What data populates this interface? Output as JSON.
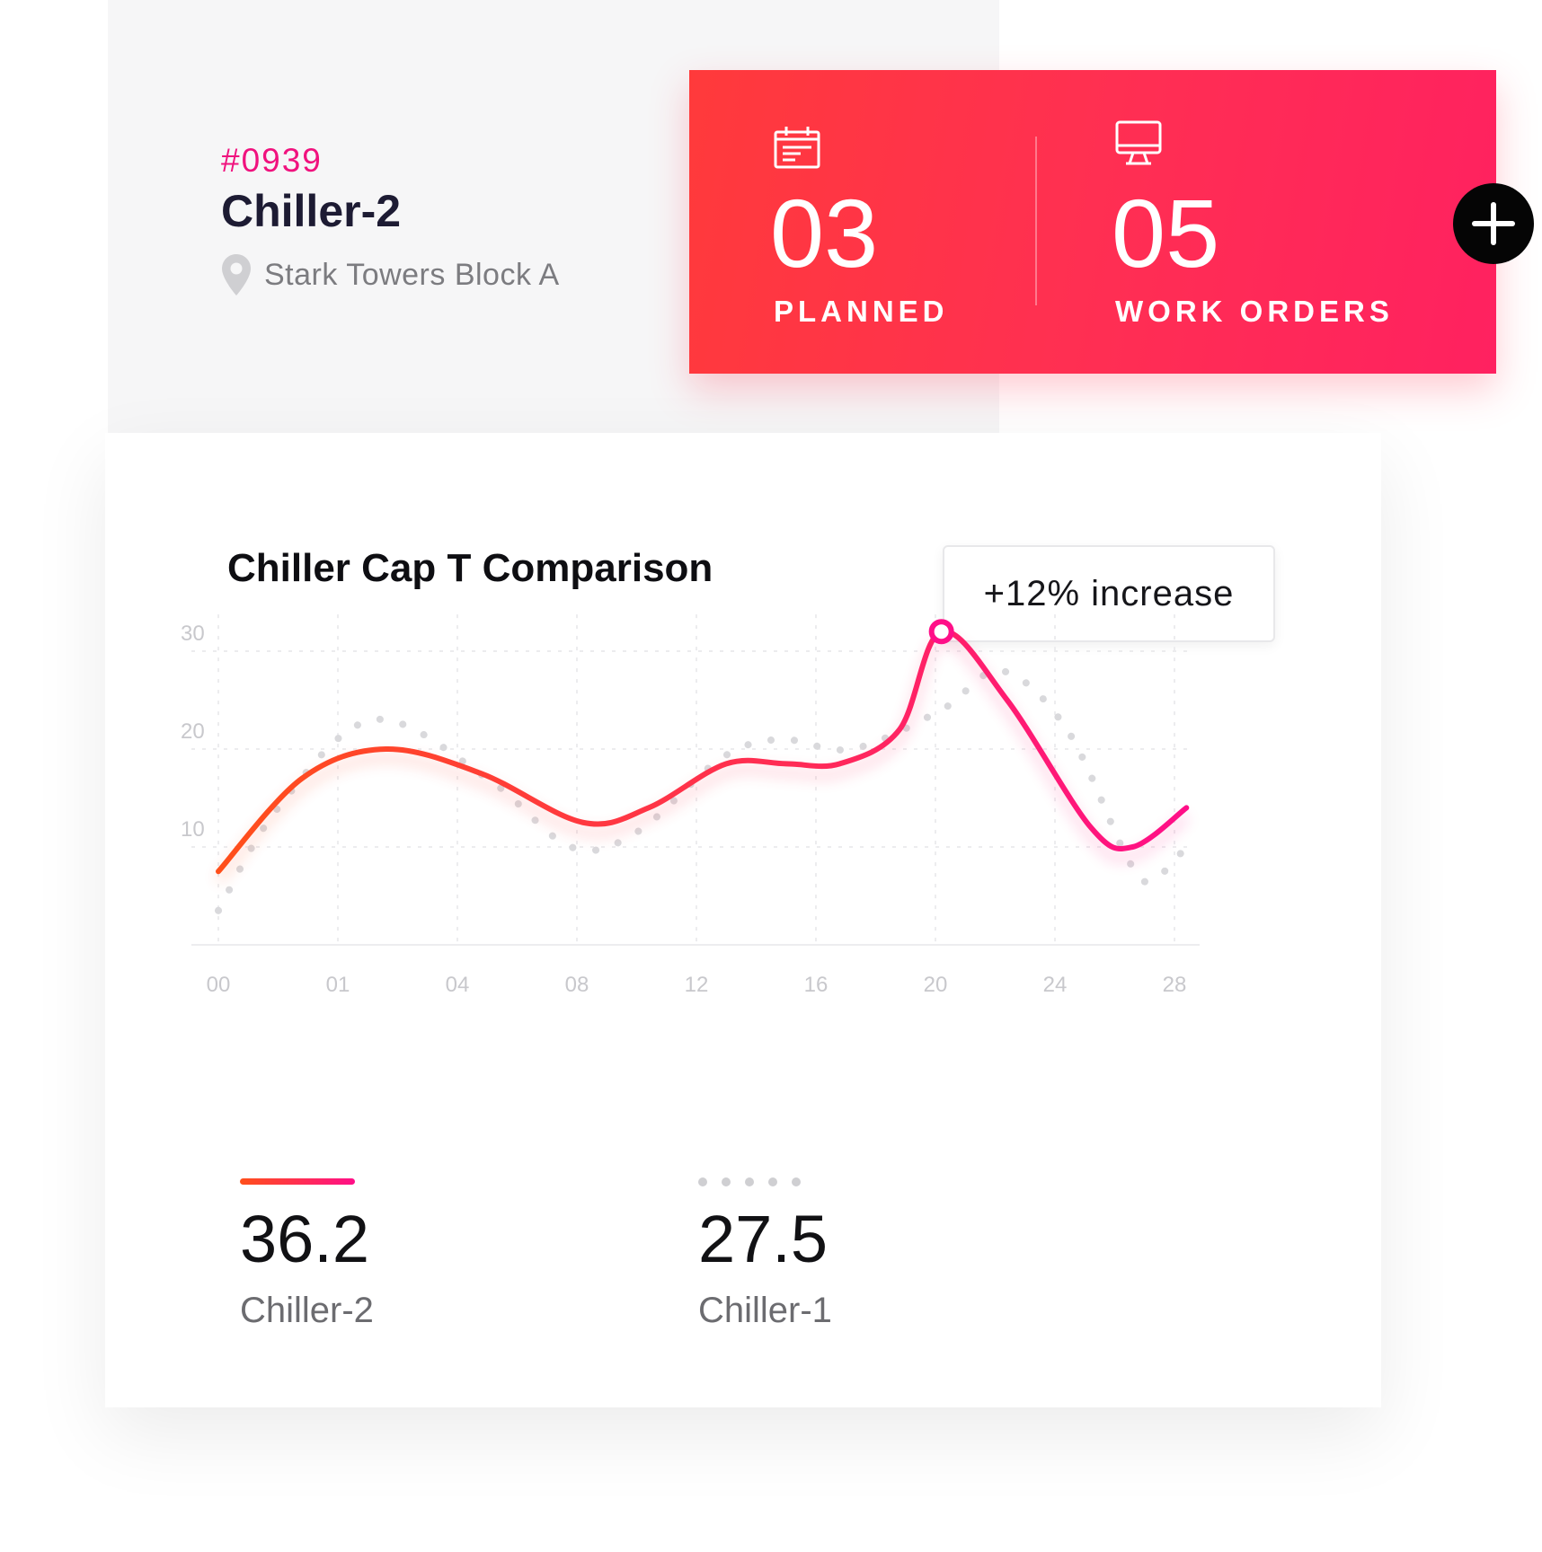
{
  "asset": {
    "id": "#0939",
    "name": "Chiller-2",
    "location": "Stark Towers Block A"
  },
  "stats": {
    "planned": {
      "value": "03",
      "label": "PLANNED"
    },
    "work_orders": {
      "value": "05",
      "label": "WORK ORDERS"
    }
  },
  "actions": {
    "add_icon": "plus-icon"
  },
  "colors": {
    "accent_start": "#ff4f1a",
    "accent_end": "#ff0f88",
    "card_gradient_start": "#ff3a3b",
    "card_gradient_end": "#ff2160",
    "secondary_series": "#cfcfd2",
    "id_color": "#f0127e"
  },
  "chart_data": {
    "type": "line",
    "title": "Chiller Cap T Comparison",
    "badge": "+12% increase",
    "categories": [
      "00",
      "01",
      "04",
      "08",
      "12",
      "16",
      "20",
      "24",
      "28"
    ],
    "x_positions": [
      0,
      1,
      2,
      3,
      4,
      5,
      6,
      7,
      8
    ],
    "y_ticks": [
      10,
      20,
      30
    ],
    "ylim": [
      0,
      31
    ],
    "grid": true,
    "series": [
      {
        "name": "Chiller-2",
        "style": "solid-gradient",
        "points": [
          [
            0,
            7.5
          ],
          [
            0.7,
            17
          ],
          [
            1.4,
            20
          ],
          [
            2.2,
            17.5
          ],
          [
            3.05,
            12.5
          ],
          [
            3.6,
            14
          ],
          [
            4.25,
            18.5
          ],
          [
            4.75,
            18.5
          ],
          [
            5.2,
            18.5
          ],
          [
            5.7,
            22
          ],
          [
            6.05,
            32
          ],
          [
            6.6,
            25
          ],
          [
            7.3,
            12
          ],
          [
            7.65,
            10
          ],
          [
            8.1,
            14
          ]
        ],
        "highlight_index": 10,
        "summary": "36.2"
      },
      {
        "name": "Chiller-1",
        "style": "dotted",
        "points": [
          [
            0,
            3.5
          ],
          [
            0.5,
            14
          ],
          [
            1.3,
            23
          ],
          [
            2.25,
            17
          ],
          [
            2.95,
            10
          ],
          [
            3.5,
            11.5
          ],
          [
            4.2,
            19
          ],
          [
            4.7,
            21
          ],
          [
            5.3,
            20
          ],
          [
            6.05,
            24
          ],
          [
            6.55,
            28
          ],
          [
            7.1,
            22
          ],
          [
            7.6,
            9
          ],
          [
            7.8,
            6.5
          ],
          [
            8.1,
            10
          ]
        ],
        "summary": "27.5"
      }
    ],
    "legend_placement": "bottom"
  }
}
